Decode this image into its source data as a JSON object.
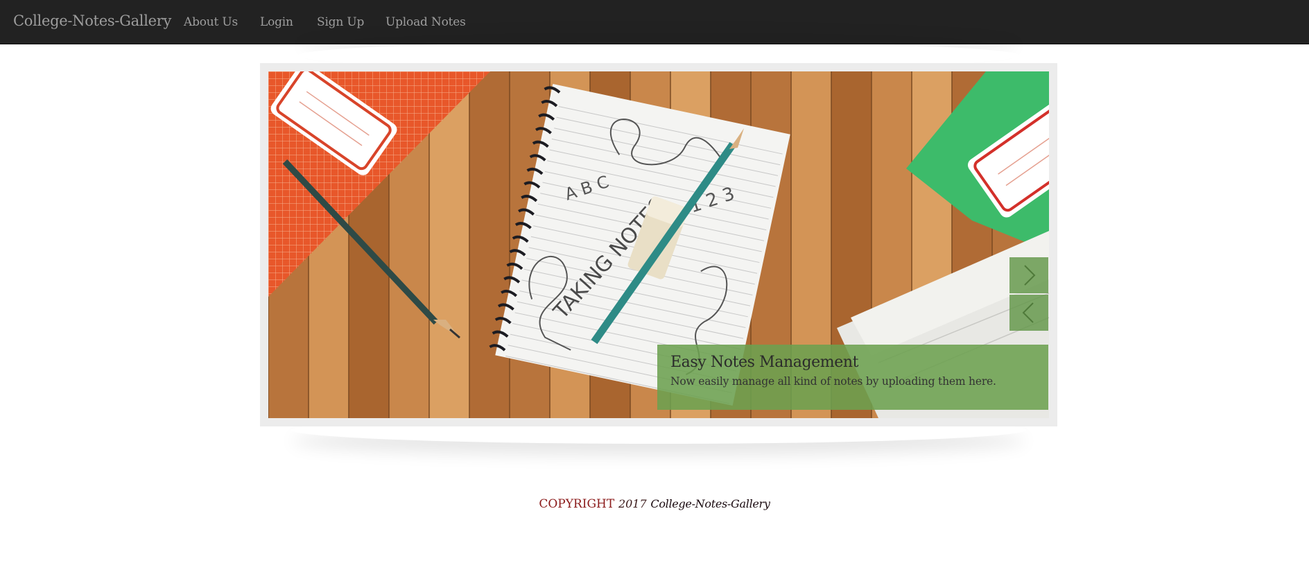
{
  "navbar": {
    "brand": "College-Notes-Gallery",
    "links": [
      {
        "label": "About Us"
      },
      {
        "label": "Login"
      },
      {
        "label": "Sign Up"
      },
      {
        "label": "Upload Notes"
      }
    ]
  },
  "slider": {
    "image_text": {
      "abc": "A B C",
      "taking_notes": "TAKING NOTES",
      "numbers": "1 2 3"
    },
    "caption": {
      "title": "Easy Notes Management",
      "text": "Now easily manage all kind of notes by uploading them here."
    },
    "next_icon": "chevron-right-icon",
    "prev_icon": "chevron-left-icon",
    "caption_color": "#6ca050"
  },
  "footer": {
    "copyright_word": "COPYRIGHT",
    "year": "2017",
    "site_name": "College-Notes-Gallery"
  },
  "colors": {
    "navbar_bg": "#222222",
    "nav_text": "#9d9d9d",
    "copyright_red": "#8b1a1a"
  }
}
